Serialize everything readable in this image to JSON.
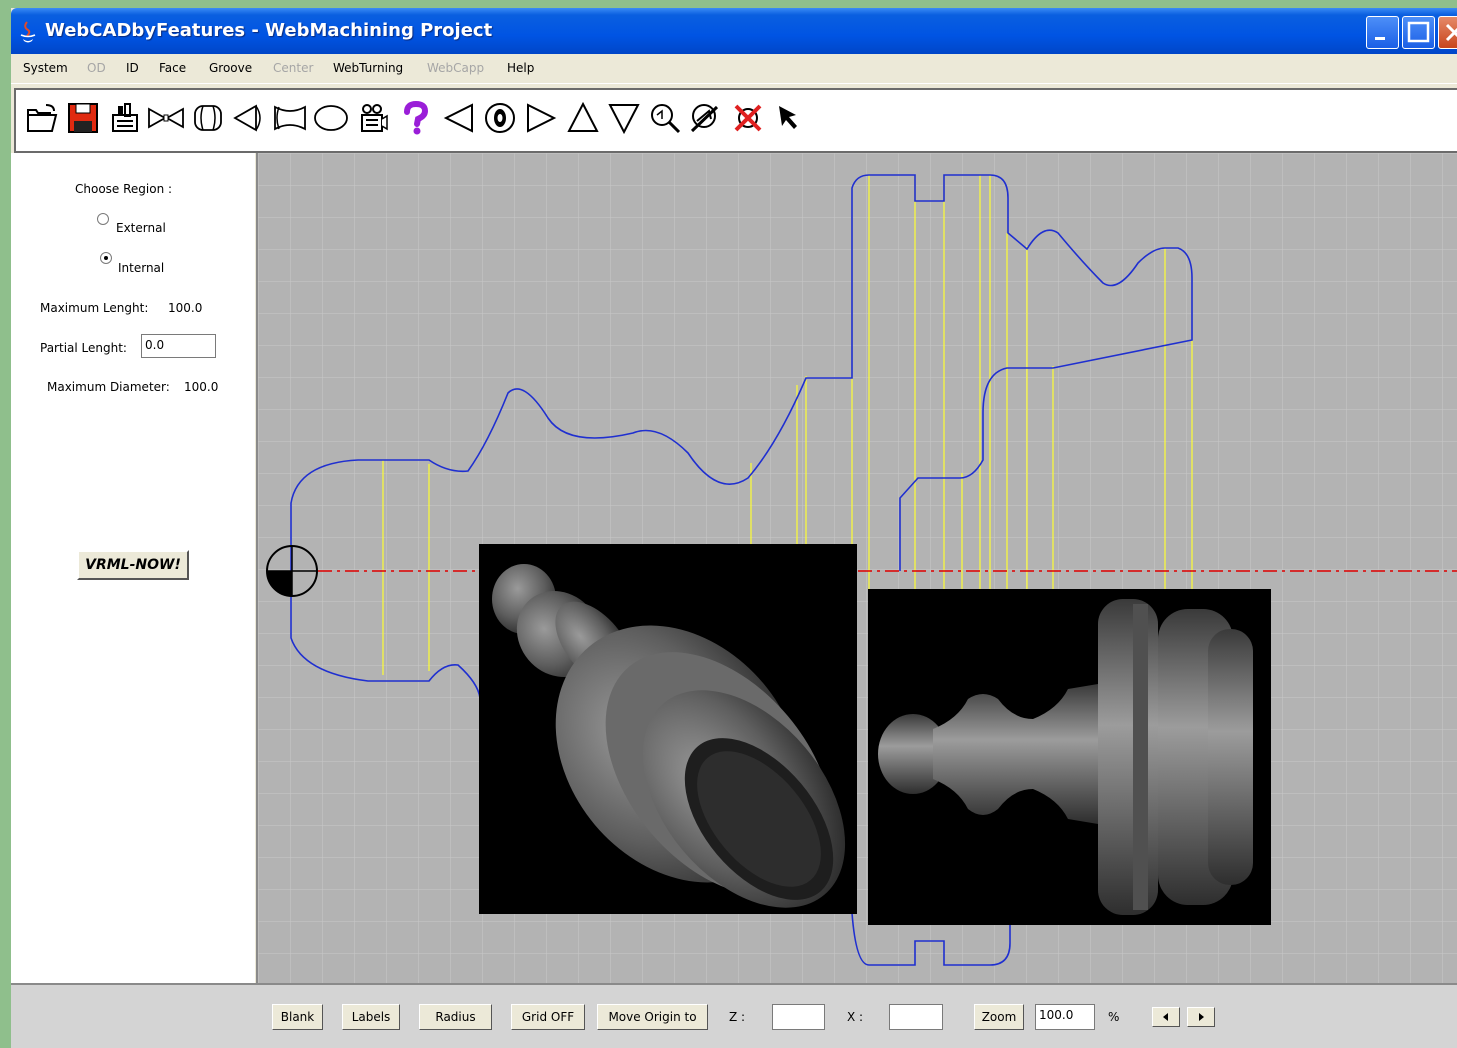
{
  "window": {
    "title": "WebCADbyFeatures - WebMachining Project"
  },
  "menu": [
    {
      "label": "System",
      "enabled": true
    },
    {
      "label": "OD",
      "enabled": false
    },
    {
      "label": "ID",
      "enabled": true
    },
    {
      "label": "Face",
      "enabled": true
    },
    {
      "label": "Groove",
      "enabled": true
    },
    {
      "label": "Center",
      "enabled": false
    },
    {
      "label": "WebTurning",
      "enabled": true
    },
    {
      "label": "WebCapp",
      "enabled": false
    },
    {
      "label": "Help",
      "enabled": true
    }
  ],
  "toolbar": {
    "tools": [
      "open-icon",
      "save-icon",
      "machine-icon",
      "hourglass-icon",
      "cylinder-icon",
      "cone-left-icon",
      "concave-icon",
      "ellipse-icon",
      "camera-icon",
      "help-icon",
      "arrow-left-icon",
      "target-icon",
      "arrow-right-icon",
      "arrow-up-icon",
      "arrow-down-icon",
      "zoom-icon",
      "zoom-rotate-icon",
      "delete-icon",
      "pointer-icon"
    ]
  },
  "panel": {
    "choose_region": "Choose Region :",
    "external": "External",
    "internal": "Internal",
    "selected_region": "Internal",
    "max_length_label": "Maximum Lenght:",
    "max_length_value": "100.0",
    "partial_length_label": "Partial Lenght:",
    "partial_length_value": "0.0",
    "max_diameter_label": "Maximum Diameter:",
    "max_diameter_value": "100.0",
    "vrml_button": "VRML-NOW!"
  },
  "bottom": {
    "blank": "Blank",
    "labels": "Labels",
    "radius": "Radius",
    "grid": "Grid OFF",
    "move_origin": "Move Origin to",
    "z_label": "Z :",
    "z_value": "",
    "x_label": "X :",
    "x_value": "",
    "zoom": "Zoom",
    "zoom_value": "100.0",
    "percent": "%"
  },
  "colors": {
    "profile": "#1f2fd0",
    "centerline": "#e00000",
    "guides": "#ffff33",
    "grid": "#c8c8c8",
    "canvas": "#b3b3b3"
  }
}
